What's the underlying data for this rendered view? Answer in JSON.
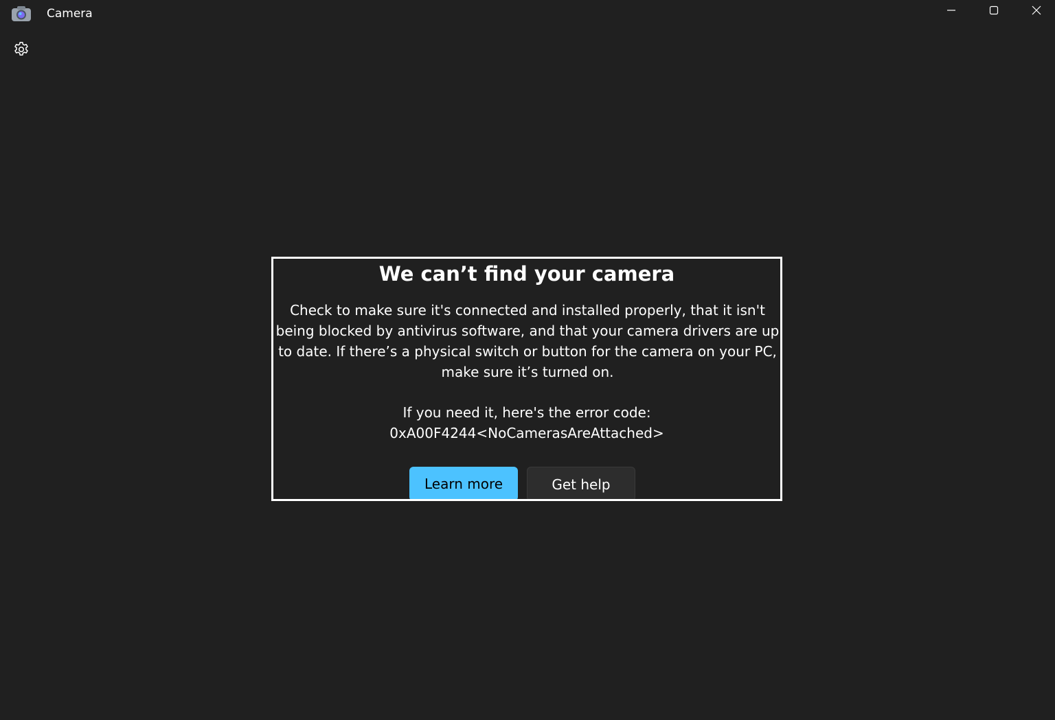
{
  "window": {
    "title": "Camera",
    "app_icon": "camera-app-icon",
    "controls": {
      "minimize_icon": "minimize-icon",
      "maximize_icon": "maximize-icon",
      "close_icon": "close-icon"
    }
  },
  "toolbar": {
    "settings_icon": "gear-icon"
  },
  "error": {
    "title": "We can’t find your camera",
    "message": "Check to make sure it's connected and installed properly, that it isn't being blocked by antivirus software, and that your camera drivers are up to date. If there’s a physical switch or button for the camera on your PC, make sure it’s turned on.",
    "code_label": "If you need it, here's the error code:",
    "code": "0xA00F4244<NoCamerasAreAttached>",
    "primary_button": "Learn more",
    "secondary_button": "Get help"
  },
  "colors": {
    "background": "#202020",
    "accent": "#4cc2ff",
    "border": "#ffffff",
    "secondary_button": "#2d2d2d"
  }
}
